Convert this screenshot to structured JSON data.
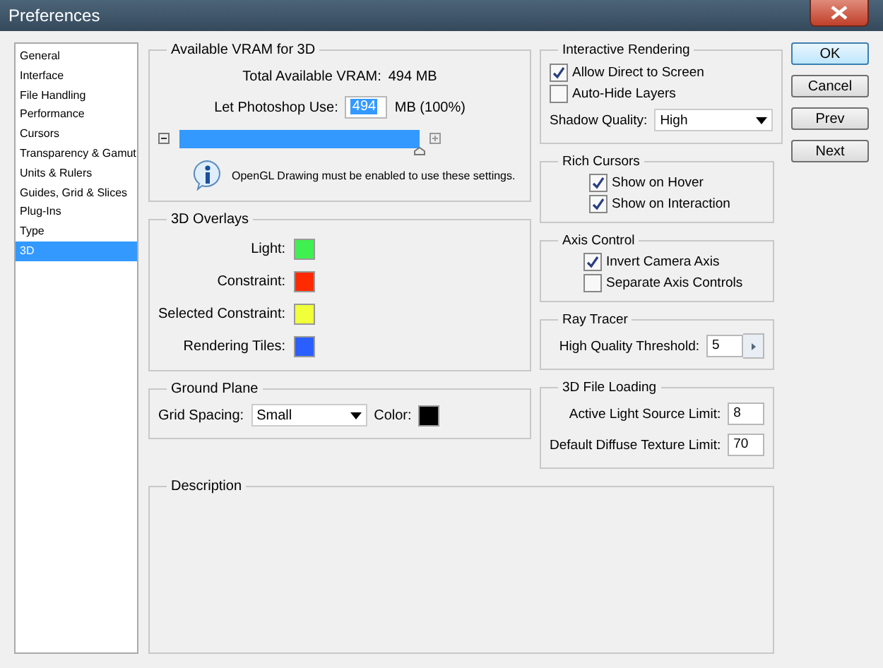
{
  "window": {
    "title": "Preferences"
  },
  "sidebar": {
    "items": [
      {
        "label": "General",
        "selected": false
      },
      {
        "label": "Interface",
        "selected": false
      },
      {
        "label": "File Handling",
        "selected": false
      },
      {
        "label": "Performance",
        "selected": false
      },
      {
        "label": "Cursors",
        "selected": false
      },
      {
        "label": "Transparency & Gamut",
        "selected": false
      },
      {
        "label": "Units & Rulers",
        "selected": false
      },
      {
        "label": "Guides, Grid & Slices",
        "selected": false
      },
      {
        "label": "Plug-Ins",
        "selected": false
      },
      {
        "label": "Type",
        "selected": false
      },
      {
        "label": "3D",
        "selected": true
      }
    ]
  },
  "vram": {
    "title": "Available VRAM for 3D",
    "total_label": "Total Available VRAM:",
    "total_value": "494 MB",
    "use_label": "Let Photoshop Use:",
    "use_value": "494",
    "use_unit": "MB (100%)",
    "level": 1.0,
    "info": "OpenGL Drawing must be enabled to use these settings."
  },
  "overlays": {
    "title": "3D Overlays",
    "items": [
      {
        "label": "Light:",
        "color": "#40f050"
      },
      {
        "label": "Constraint:",
        "color": "#ff2a00"
      },
      {
        "label": "Selected Constraint:",
        "color": "#f0ff3a"
      },
      {
        "label": "Rendering Tiles:",
        "color": "#2a5eff"
      }
    ]
  },
  "ground_plane": {
    "title": "Ground Plane",
    "spacing_label": "Grid Spacing:",
    "spacing_value": "Small",
    "color_label": "Color:",
    "color": "#000000"
  },
  "description": {
    "title": "Description"
  },
  "interactive_rendering": {
    "title": "Interactive Rendering",
    "options": [
      {
        "label": "Allow Direct to Screen",
        "checked": true
      },
      {
        "label": "Auto-Hide Layers",
        "checked": false
      }
    ],
    "shadow_label": "Shadow Quality:",
    "shadow_value": "High"
  },
  "rich_cursors": {
    "title": "Rich Cursors",
    "options": [
      {
        "label": "Show on Hover",
        "checked": true
      },
      {
        "label": "Show on Interaction",
        "checked": true
      }
    ]
  },
  "axis_control": {
    "title": "Axis Control",
    "options": [
      {
        "label": "Invert Camera Axis",
        "checked": true
      },
      {
        "label": "Separate Axis Controls",
        "checked": false
      }
    ]
  },
  "ray_tracer": {
    "title": "Ray Tracer",
    "threshold_label": "High Quality Threshold:",
    "threshold_value": "5"
  },
  "file_loading": {
    "title": "3D File Loading",
    "fields": [
      {
        "label": "Active Light Source Limit:",
        "value": "8"
      },
      {
        "label": "Default Diffuse Texture Limit:",
        "value": "70"
      }
    ]
  },
  "buttons": [
    {
      "label": "OK",
      "kind": "default"
    },
    {
      "label": "Cancel",
      "kind": "normal"
    },
    {
      "label": "Prev",
      "kind": "normal"
    },
    {
      "label": "Next",
      "kind": "normal"
    }
  ]
}
